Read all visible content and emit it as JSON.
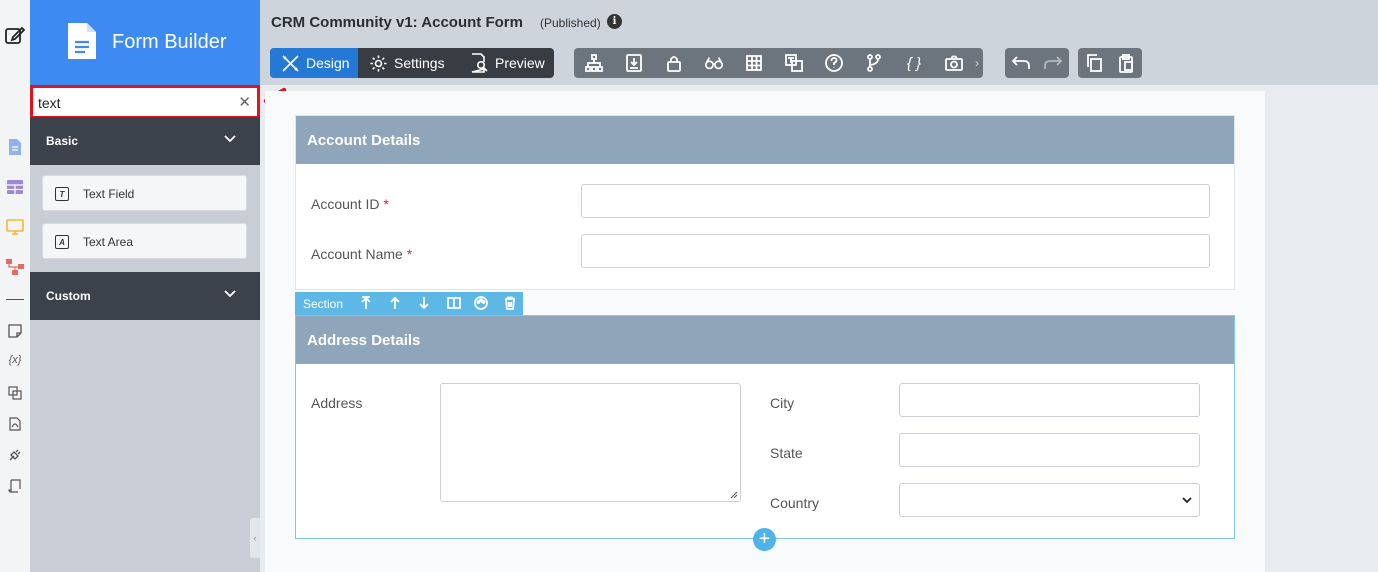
{
  "sidebar": {
    "brand_title": "Form Builder",
    "search": {
      "value": "text",
      "placeholder": ""
    },
    "groups": [
      {
        "label": "Basic",
        "items": [
          {
            "label": "Text Field",
            "icon_letter": "T"
          },
          {
            "label": "Text Area",
            "icon_letter": "A"
          }
        ]
      },
      {
        "label": "Custom"
      }
    ]
  },
  "header": {
    "title": "CRM Community v1: Account Form",
    "status": "(Published)",
    "info_symbol": "i",
    "tabs": [
      {
        "label": "Design",
        "icon": "design-icon"
      },
      {
        "label": "Settings",
        "icon": "gear-icon"
      },
      {
        "label": "Preview",
        "icon": "preview-icon"
      }
    ],
    "curly_label": "{ }"
  },
  "form": {
    "sections": [
      {
        "title": "Account Details",
        "fields": [
          {
            "label": "Account ID",
            "required_mark": "*"
          },
          {
            "label": "Account Name",
            "required_mark": "*"
          }
        ]
      },
      {
        "title": "Address Details",
        "toolbar_label": "Section",
        "left_fields": [
          {
            "label": "Address"
          }
        ],
        "right_fields": [
          {
            "label": "City"
          },
          {
            "label": "State"
          },
          {
            "label": "Country"
          }
        ]
      }
    ],
    "add_symbol": "+"
  },
  "colors": {
    "brand": "#3d8bf2",
    "accent": "#2579d6",
    "highlight": "#e0141e",
    "section_header": "#8fa5ba",
    "selected_section": "#5eb8e5"
  }
}
